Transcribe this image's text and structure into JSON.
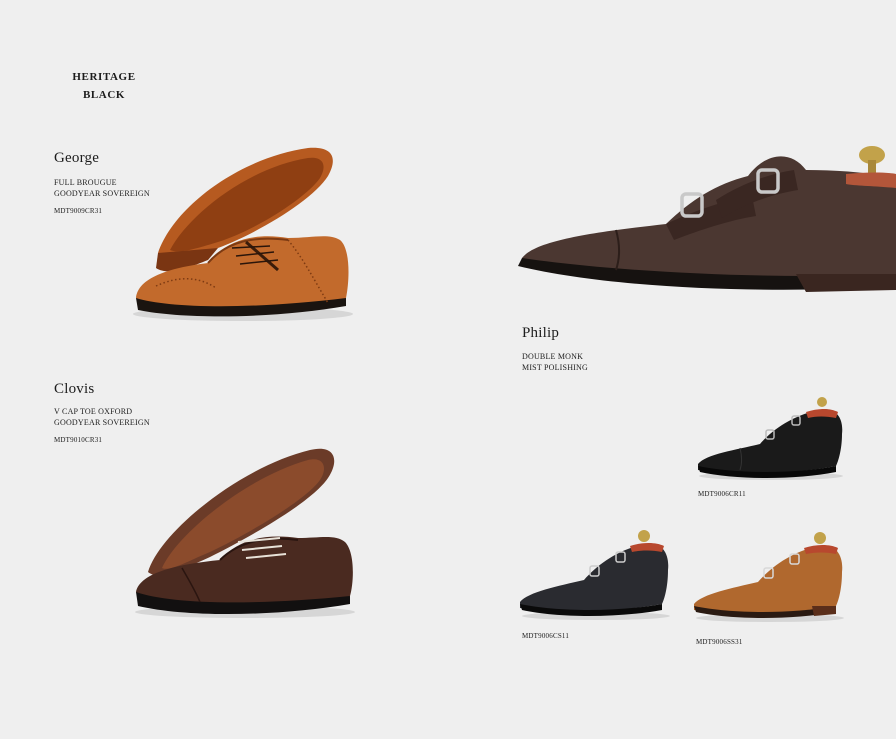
{
  "collection": {
    "line1": "HERITAGE",
    "line2": "BLACK"
  },
  "products": {
    "george": {
      "name": "George",
      "desc1": "FULL BROUGUE",
      "desc2": "GOODYEAR SOVEREIGN",
      "sku": "MDT9009CR31",
      "color": "#b8622a",
      "image_icon": "brogue-shoe-image"
    },
    "clovis": {
      "name": "Clovis",
      "desc1": "V CAP TOE OXFORD",
      "desc2": "GOODYEAR SOVEREIGN",
      "sku": "MDT9010CR31",
      "color": "#4e2f24",
      "image_icon": "oxford-shoe-image"
    },
    "philip": {
      "name": "Philip",
      "desc1": "DOUBLE MONK",
      "desc2": "MIST POLISHING",
      "color": "#4a3832",
      "image_icon": "double-monk-shoe-image",
      "variants": [
        {
          "sku": "MDT9006CR11",
          "color": "#161616"
        },
        {
          "sku": "MDT9006CS11",
          "color": "#26272b"
        },
        {
          "sku": "MDT9006SS31",
          "color": "#b06a32"
        }
      ]
    }
  }
}
